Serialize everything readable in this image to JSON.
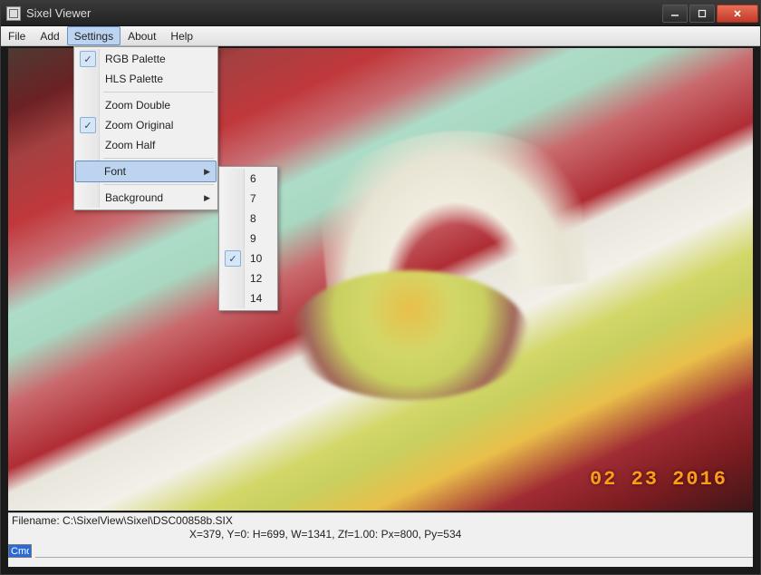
{
  "window": {
    "title": "Sixel Viewer"
  },
  "menubar": {
    "items": [
      {
        "label": "File"
      },
      {
        "label": "Add"
      },
      {
        "label": "Settings"
      },
      {
        "label": "About"
      },
      {
        "label": "Help"
      }
    ]
  },
  "settings_menu": {
    "rgb": "RGB Palette",
    "hls": "HLS Palette",
    "zoom_double": "Zoom Double",
    "zoom_original": "Zoom Original",
    "zoom_half": "Zoom Half",
    "font": "Font",
    "background": "Background",
    "checked": {
      "rgb": true,
      "zoom_original": true
    }
  },
  "font_menu": {
    "sizes": [
      "6",
      "7",
      "8",
      "9",
      "10",
      "12",
      "14"
    ],
    "checked": "10"
  },
  "image": {
    "datestamp": "02 23 2016"
  },
  "status": {
    "filename_label": "Filename: C:\\SixelView\\Sixel\\DSC00858b.SIX",
    "metrics": "X=379, Y=0: H=699, W=1341, Zf=1.00: Px=800, Py=534",
    "cmd_value": "Cmd"
  }
}
